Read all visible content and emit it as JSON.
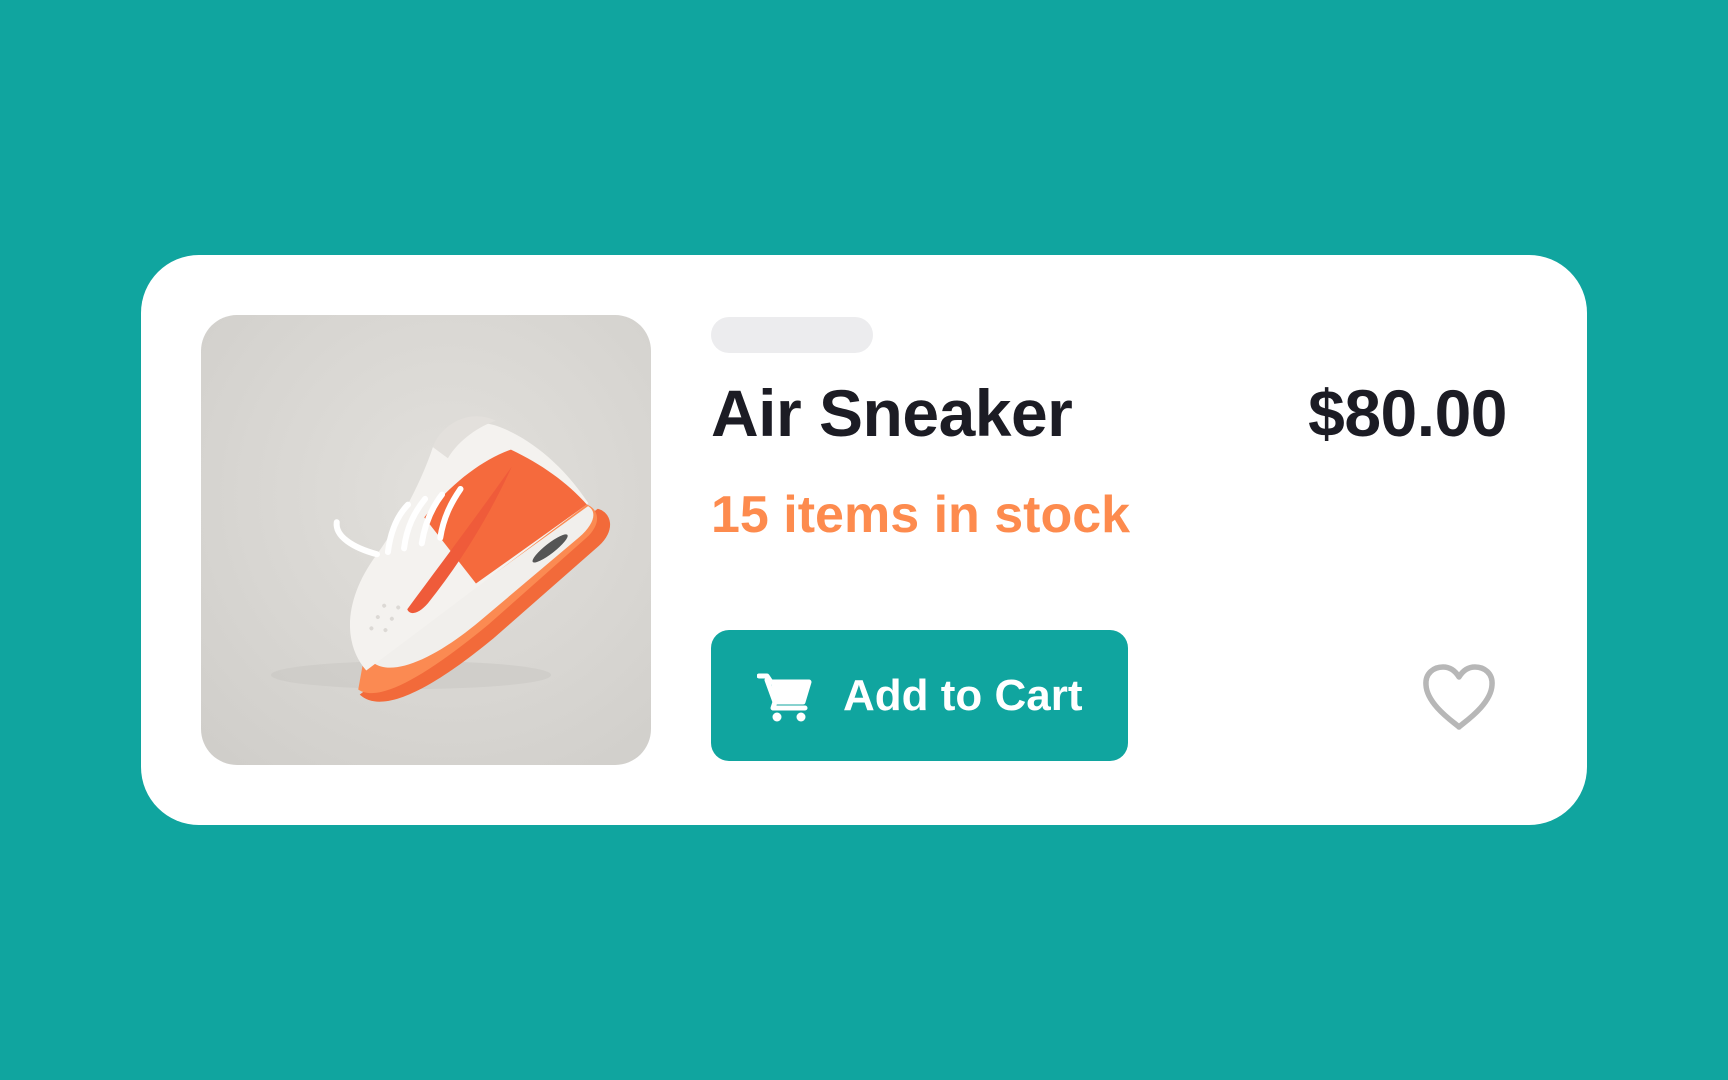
{
  "colors": {
    "background": "#10a59f",
    "card": "#ffffff",
    "title_text": "#1c1c24",
    "stock_text": "#fd8b4e",
    "button_bg": "#10a59f",
    "button_text": "#ffffff",
    "heart_outline": "#b7b7b7"
  },
  "product": {
    "image_icon": "sneaker-photo",
    "name": "Air Sneaker",
    "price": "$80.00",
    "stock": "15 items in stock"
  },
  "actions": {
    "add_to_cart_label": "Add to Cart",
    "add_to_cart_icon": "shopping-cart-icon",
    "favorite_icon": "heart-outline-icon"
  }
}
